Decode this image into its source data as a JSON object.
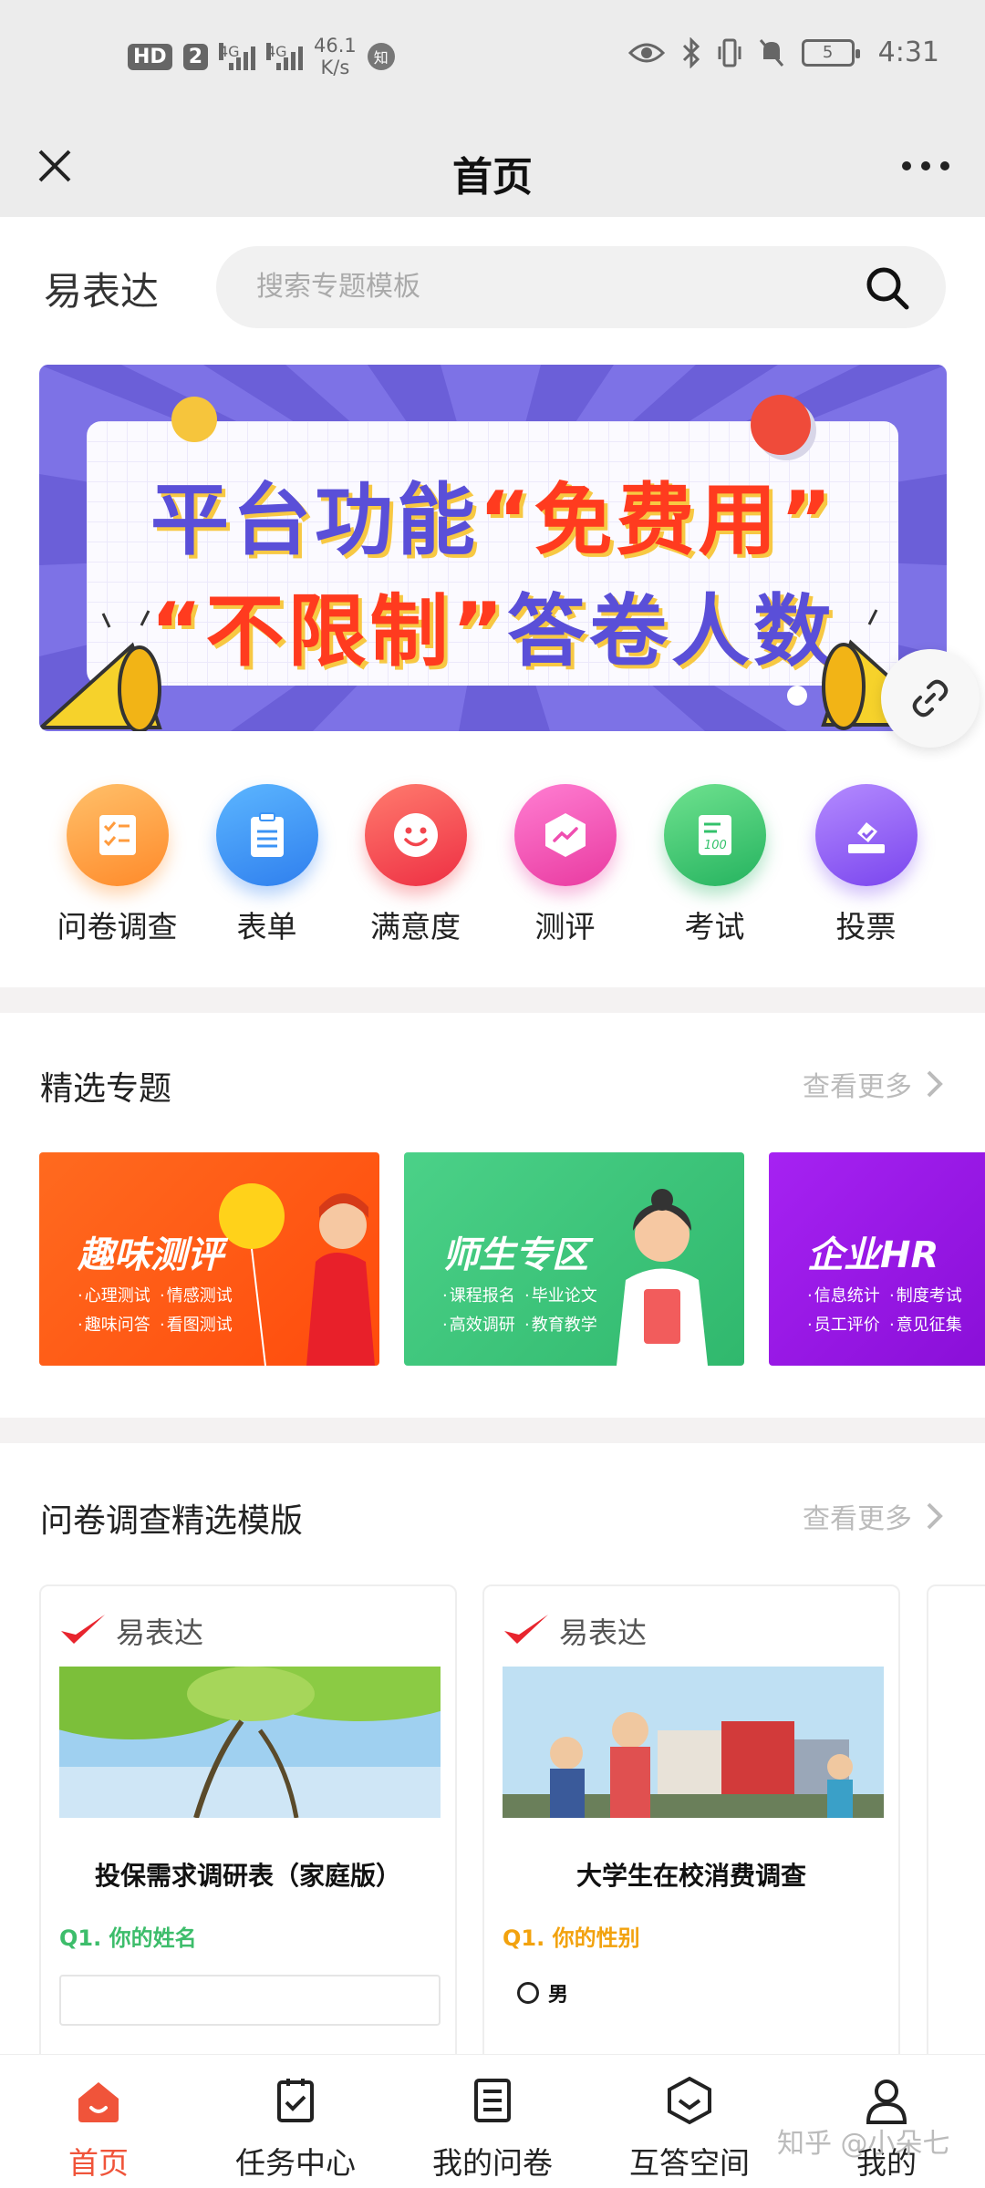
{
  "status_bar": {
    "hd_label": "HD",
    "sim_label": "2",
    "net1": "4G",
    "net2": "4G",
    "speed_value": "46.1",
    "speed_unit": "K/s",
    "app_badge": "知",
    "battery": "5",
    "time": "4:31"
  },
  "title_bar": {
    "title": "首页"
  },
  "header": {
    "brand": "易表达",
    "search_placeholder": "搜索专题模板"
  },
  "banner": {
    "line1_a": "平台功能",
    "line1_b": "“免费用”",
    "line2_a": "“不限制”",
    "line2_b": "答卷人数"
  },
  "categories": [
    {
      "label": "问卷调查",
      "icon": "checklist-icon",
      "color": "#ff9b3d"
    },
    {
      "label": "表单",
      "icon": "clipboard-icon",
      "color": "#3b93f5"
    },
    {
      "label": "满意度",
      "icon": "smile-icon",
      "color": "#f2454d"
    },
    {
      "label": "测评",
      "icon": "chart-hexagon-icon",
      "color": "#ef4fb0"
    },
    {
      "label": "考试",
      "icon": "exam-paper-icon",
      "color": "#33c26b"
    },
    {
      "label": "投票",
      "icon": "ballot-box-icon",
      "color": "#8a5cf0"
    }
  ],
  "featured": {
    "title": "精选专题",
    "more": "查看更多",
    "topics": [
      {
        "title": "趣味测评",
        "tags": [
          "心理测试",
          "情感测试",
          "趣味问答",
          "看图测试"
        ],
        "color": "#ff5a16"
      },
      {
        "title": "师生专区",
        "tags": [
          "课程报名",
          "毕业论文",
          "高效调研",
          "教育教学"
        ],
        "color": "#3ec27a"
      },
      {
        "title": "企业HR",
        "tags": [
          "信息统计",
          "制度考试",
          "员工评价",
          "意见征集"
        ],
        "color": "#9b17e8"
      }
    ]
  },
  "templates": {
    "title": "问卷调查精选模版",
    "more": "查看更多",
    "cards": [
      {
        "logo": "易表达",
        "title": "投保需求调研表（家庭版）",
        "question": "Q1. 你的姓名",
        "q_color": "#3dbd6b"
      },
      {
        "logo": "易表达",
        "title": "大学生在校消费调查",
        "question": "Q1. 你的性别",
        "q_color": "#f2a20e",
        "option": "男"
      }
    ]
  },
  "bottom_nav": [
    {
      "label": "首页",
      "icon": "home-icon",
      "active": true
    },
    {
      "label": "任务中心",
      "icon": "task-check-icon"
    },
    {
      "label": "我的问卷",
      "icon": "document-list-icon"
    },
    {
      "label": "互答空间",
      "icon": "hexagon-chevron-icon"
    },
    {
      "label": "我的",
      "icon": "user-icon"
    }
  ],
  "watermark": "知乎 @小朵七",
  "colors": {
    "accent": "#f0543a",
    "banner_bg": "#7d72e6"
  }
}
